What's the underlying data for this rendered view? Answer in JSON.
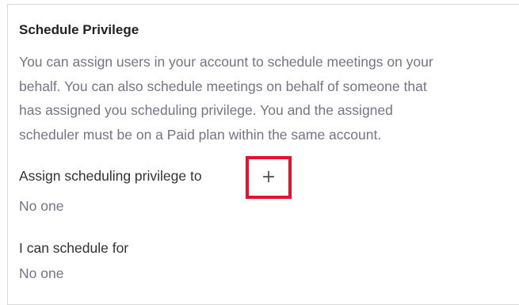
{
  "section": {
    "title": "Schedule Privilege",
    "description_lines": [
      "You can assign users in your account to schedule meetings on your",
      "behalf. You can also schedule meetings on behalf of someone that",
      "has assigned you scheduling privilege. You and the assigned",
      "scheduler must be on a Paid plan within the same account."
    ]
  },
  "assign": {
    "label": "Assign scheduling privilege to",
    "add_icon": "plus-icon",
    "add_symbol": "+",
    "value": "No one"
  },
  "schedule_for": {
    "label": "I can schedule for",
    "value": "No one"
  },
  "colors": {
    "highlight_border": "#e8112d",
    "description_text": "#747487"
  }
}
